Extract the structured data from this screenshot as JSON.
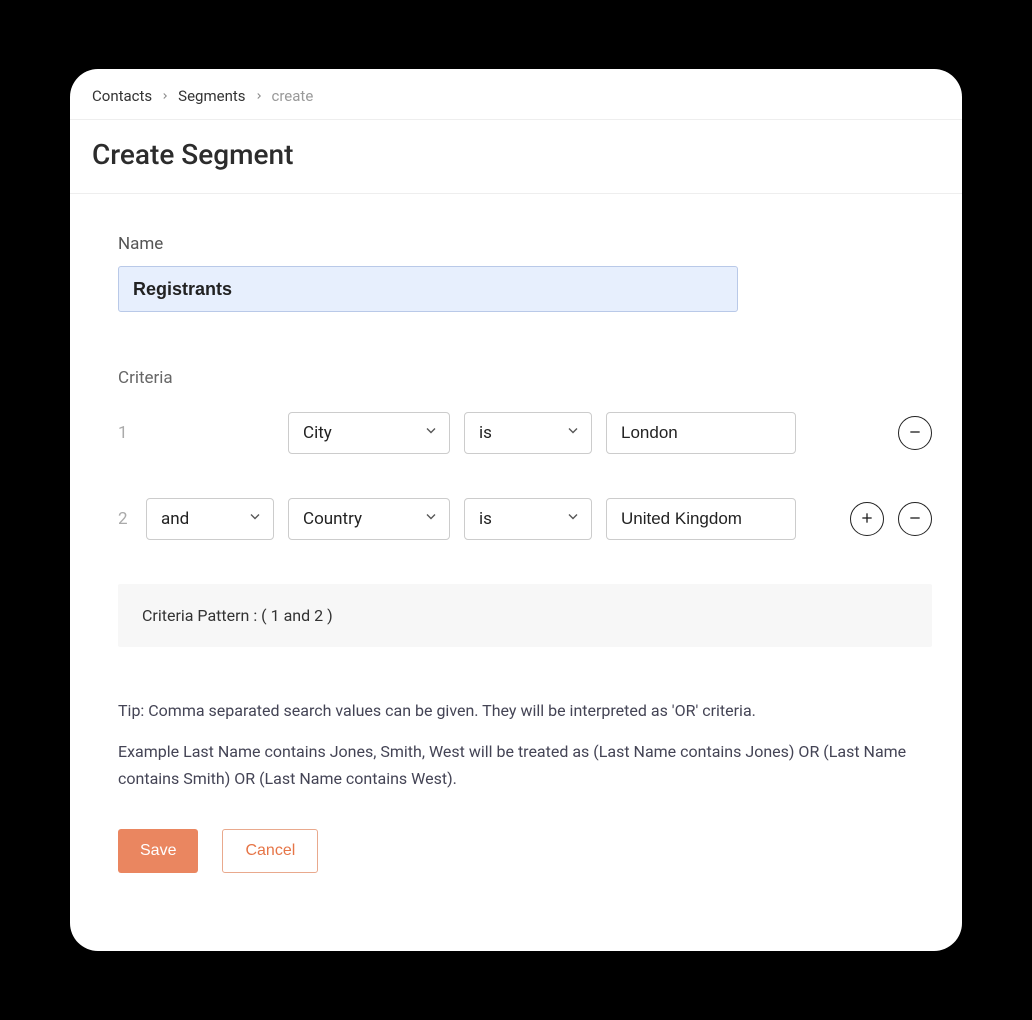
{
  "breadcrumb": {
    "items": [
      "Contacts",
      "Segments"
    ],
    "current": "create"
  },
  "page_title": "Create Segment",
  "form": {
    "name_label": "Name",
    "name_value": "Registrants",
    "criteria_label": "Criteria",
    "criteria": [
      {
        "num": "1",
        "logic": null,
        "field": "City",
        "operator": "is",
        "value": "London",
        "show_add": false,
        "show_remove": true
      },
      {
        "num": "2",
        "logic": "and",
        "field": "Country",
        "operator": "is",
        "value": "United Kingdom",
        "show_add": true,
        "show_remove": true
      }
    ],
    "pattern_label": "Criteria Pattern : ( 1 and 2 )",
    "tip_line1": "Tip: Comma separated search values can be given. They will be interpreted as 'OR' criteria.",
    "tip_line2": "Example  Last Name contains Jones, Smith, West will be treated as (Last Name contains Jones) OR (Last Name contains Smith) OR (Last Name contains West).",
    "save_label": "Save",
    "cancel_label": "Cancel"
  }
}
